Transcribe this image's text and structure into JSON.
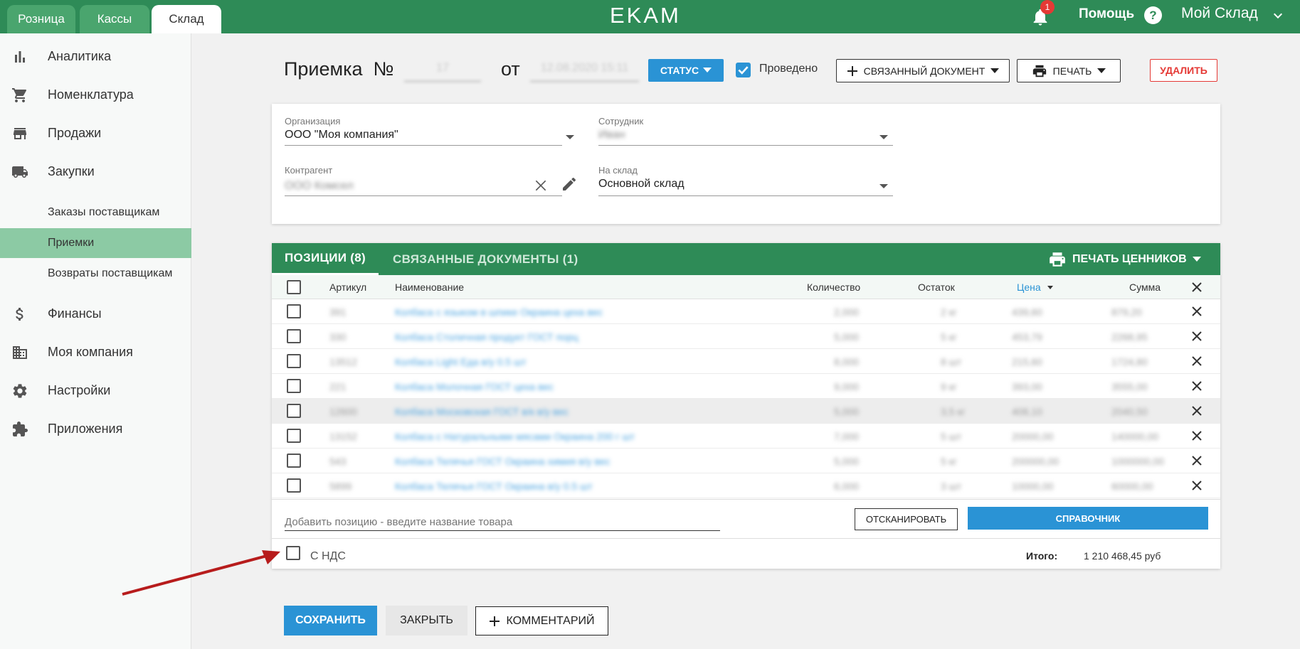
{
  "topbar": {
    "tabs": [
      "Розница",
      "Кассы",
      "Склад"
    ],
    "active_tab": "Склад",
    "logo": "EKAM",
    "notifications_count": "1",
    "help_label": "Помощь",
    "account_label": "Мой Склад"
  },
  "sidebar": {
    "items": [
      {
        "label": "Аналитика",
        "icon": "bar-chart-icon"
      },
      {
        "label": "Номенклатура",
        "icon": "cart-icon"
      },
      {
        "label": "Продажи",
        "icon": "store-icon"
      },
      {
        "label": "Закупки",
        "icon": "truck-icon"
      },
      {
        "label": "Финансы",
        "icon": "dollar-icon"
      },
      {
        "label": "Моя компания",
        "icon": "building-icon"
      },
      {
        "label": "Настройки",
        "icon": "gear-icon"
      },
      {
        "label": "Приложения",
        "icon": "puzzle-icon"
      }
    ],
    "sub_items": [
      "Заказы поставщикам",
      "Приемки",
      "Возвраты поставщикам"
    ],
    "active_sub_item": "Приемки"
  },
  "header": {
    "title": "Приемка",
    "number_sign": "№",
    "number_value": "17",
    "date_prefix": "от",
    "date_value": "12.08.2020 15:11",
    "status_label": "СТАТУС",
    "done_label": "Проведено",
    "done_checked": true,
    "linked_doc_label": "СВЯЗАННЫЙ ДОКУМЕНТ",
    "print_label": "ПЕЧАТЬ",
    "delete_label": "УДАЛИТЬ"
  },
  "form": {
    "organization": {
      "label": "Организация",
      "value": "ООО \"Моя компания\""
    },
    "employee": {
      "label": "Сотрудник",
      "value": "Иван"
    },
    "counterparty": {
      "label": "Контрагент",
      "value": "ООО Комсел"
    },
    "warehouse": {
      "label": "На склад",
      "value": "Основной склад"
    }
  },
  "positions": {
    "tabs": [
      "ПОЗИЦИИ (8)",
      "СВЯЗАННЫЕ ДОКУМЕНТЫ (1)"
    ],
    "print_tags_label": "ПЕЧАТЬ ЦЕННИКОВ",
    "columns": [
      "Артикул",
      "Наименование",
      "Количество",
      "Остаток",
      "Цена",
      "Сумма"
    ],
    "sorted_column": "Цена",
    "rows": [
      {
        "sku": "391",
        "name": "Колбаса с языком в шпике Окраина цеха вес",
        "qty": "2,000",
        "stock": "2 кг",
        "price": "439,60",
        "sum": "879,20"
      },
      {
        "sku": "330",
        "name": "Колбаса Столичная продукт ГОСТ порц",
        "qty": "5,000",
        "stock": "5 кг",
        "price": "453,79",
        "sum": "2268,95"
      },
      {
        "sku": "13512",
        "name": "Колбаса Light Еда в/у 0.5 шт",
        "qty": "8,000",
        "stock": "8 шт",
        "price": "215,60",
        "sum": "1724,80"
      },
      {
        "sku": "221",
        "name": "Колбаса Молочная ГОСТ цеха вес",
        "qty": "9,000",
        "stock": "9 кг",
        "price": "393,00",
        "sum": "3555,00"
      },
      {
        "sku": "12600",
        "name": "Колбаса Московская ГОСТ в/к в/у вес",
        "qty": "5,000",
        "stock": "3,5 кг",
        "price": "408,10",
        "sum": "2040,50"
      },
      {
        "sku": "13152",
        "name": "Колбаса с Натуральными мясами Окраина 200 г шт",
        "qty": "7,000",
        "stock": "5 шт",
        "price": "20000,00",
        "sum": "140000,00"
      },
      {
        "sku": "543",
        "name": "Колбаса Телячья ГОСТ Окраина химия в/у вес",
        "qty": "5,000",
        "stock": "5 кг",
        "price": "200000,00",
        "sum": "1000000,00"
      },
      {
        "sku": "5899",
        "name": "Колбаса Телячья ГОСТ Окраина в/у 0.5 шт",
        "qty": "6,000",
        "stock": "3 шт",
        "price": "10000,00",
        "sum": "60000,00"
      }
    ],
    "add_placeholder": "Добавить позицию - введите название товара",
    "scan_label": "ОТСКАНИРОВАТЬ",
    "catalog_label": "СПРАВОЧНИК",
    "vat_label": "С НДС",
    "total_label": "Итого:",
    "total_value": "1 210 468,45 руб"
  },
  "actions": {
    "save_label": "СОХРАНИТЬ",
    "close_label": "ЗАКРЫТЬ",
    "comment_label": "КОММЕНТАРИЙ"
  },
  "colors": {
    "brand_green": "#2e8b57",
    "accent_blue": "#2a93d5",
    "danger_red": "#e53935",
    "annotation_arrow": "#b71c1c"
  }
}
